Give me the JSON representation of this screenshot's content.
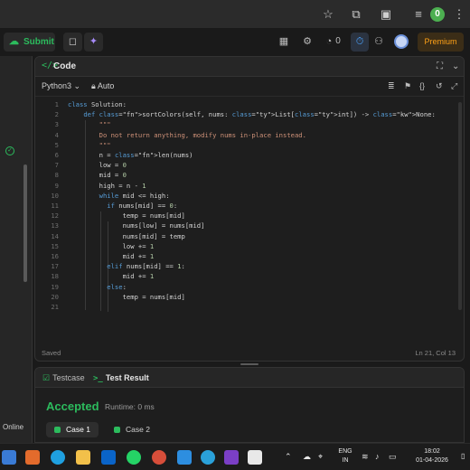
{
  "browser": {
    "profile_badge": "0",
    "icons": [
      "star-icon",
      "extensions-icon",
      "tab-search-icon",
      "media-icon",
      "profile-icon",
      "menu-icon"
    ]
  },
  "toolbar": {
    "submit_label": "Submit",
    "notification_count": "0",
    "premium_label": "Premium"
  },
  "left_panel": {
    "status_label": "Online"
  },
  "code_panel": {
    "title": "Code",
    "language": "Python3",
    "mode": "Auto",
    "saved_label": "Saved",
    "cursor_position": "Ln 21, Col 13",
    "lines": [
      {
        "n": "1",
        "text": "class Solution:"
      },
      {
        "n": "2",
        "text": "    def sortColors(self, nums: List[int]) -> None:"
      },
      {
        "n": "3",
        "text": "        \"\"\""
      },
      {
        "n": "4",
        "text": "        Do not return anything, modify nums in-place instead."
      },
      {
        "n": "5",
        "text": "        \"\"\""
      },
      {
        "n": "6",
        "text": "        n = len(nums)"
      },
      {
        "n": "7",
        "text": "        low = 0"
      },
      {
        "n": "8",
        "text": "        mid = 0"
      },
      {
        "n": "9",
        "text": "        high = n - 1"
      },
      {
        "n": "10",
        "text": "        while mid <= high:"
      },
      {
        "n": "11",
        "text": "          if nums[mid] == 0:"
      },
      {
        "n": "12",
        "text": "              temp = nums[mid]"
      },
      {
        "n": "13",
        "text": "              nums[low] = nums[mid]"
      },
      {
        "n": "14",
        "text": "              nums[mid] = temp"
      },
      {
        "n": "15",
        "text": "              low += 1"
      },
      {
        "n": "16",
        "text": "              mid += 1"
      },
      {
        "n": "17",
        "text": "          elif nums[mid] == 1:"
      },
      {
        "n": "18",
        "text": "              mid += 1"
      },
      {
        "n": "19",
        "text": "          else:"
      },
      {
        "n": "20",
        "text": "              temp = nums[mid]"
      },
      {
        "n": "21",
        "text": ""
      }
    ]
  },
  "result_panel": {
    "tab_testcase": "Testcase",
    "tab_result": "Test Result",
    "status": "Accepted",
    "runtime": "Runtime: 0 ms",
    "cases": [
      "Case 1",
      "Case 2"
    ]
  },
  "taskbar": {
    "lang_top": "ENG",
    "lang_bottom": "IN",
    "time": "18:02",
    "date": "01-04-2026"
  },
  "colors": {
    "accent_green": "#2cbb5d",
    "premium_orange": "#ffa116",
    "keyword_blue": "#569cd6"
  }
}
